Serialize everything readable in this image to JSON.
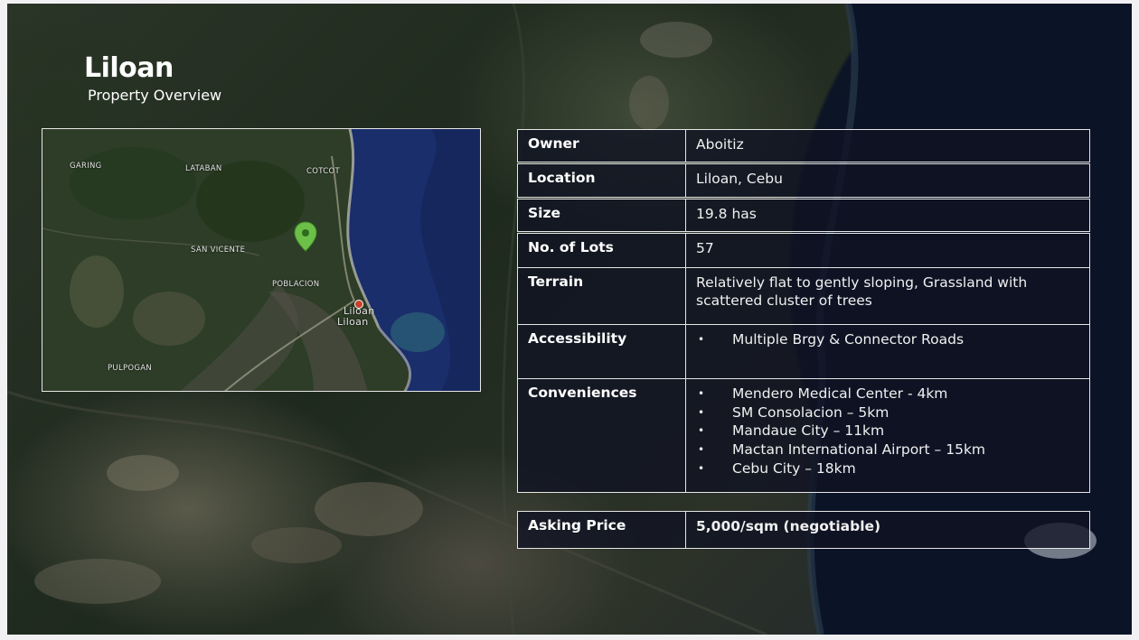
{
  "header": {
    "title": "Liloan",
    "subtitle": "Property Overview"
  },
  "map": {
    "labels": {
      "garing": "GARING",
      "lataban": "LATABAN",
      "cotcot": "COTCOT",
      "san_vicente": "SAN VICENTE",
      "poblacion": "POBLACION",
      "liloan": "Liloan",
      "pulpogan": "PULPOGAN"
    },
    "pin_color": "#6cc04a"
  },
  "details": {
    "owner": {
      "label": "Owner",
      "value": "Aboitiz"
    },
    "location": {
      "label": "Location",
      "value": "Liloan, Cebu"
    },
    "size": {
      "label": "Size",
      "value": "19.8 has"
    },
    "lots": {
      "label": "No. of Lots",
      "value": "57"
    },
    "terrain": {
      "label": "Terrain",
      "value": "Relatively flat to gently sloping, Grassland with scattered cluster of trees"
    },
    "accessibility": {
      "label": "Accessibility",
      "items": [
        "Multiple Brgy & Connector Roads"
      ]
    },
    "conveniences": {
      "label": "Conveniences",
      "items": [
        "Mendero Medical Center - 4km",
        "SM Consolacion – 5km",
        "Mandaue City – 11km",
        "Mactan International Airport – 15km",
        "Cebu City – 18km"
      ]
    },
    "price": {
      "label": "Asking Price",
      "value": "5,000/sqm (negotiable)"
    }
  },
  "colors": {
    "row_background": "#0f1222",
    "border": "#e6e6e6",
    "sea": "#13245a"
  }
}
